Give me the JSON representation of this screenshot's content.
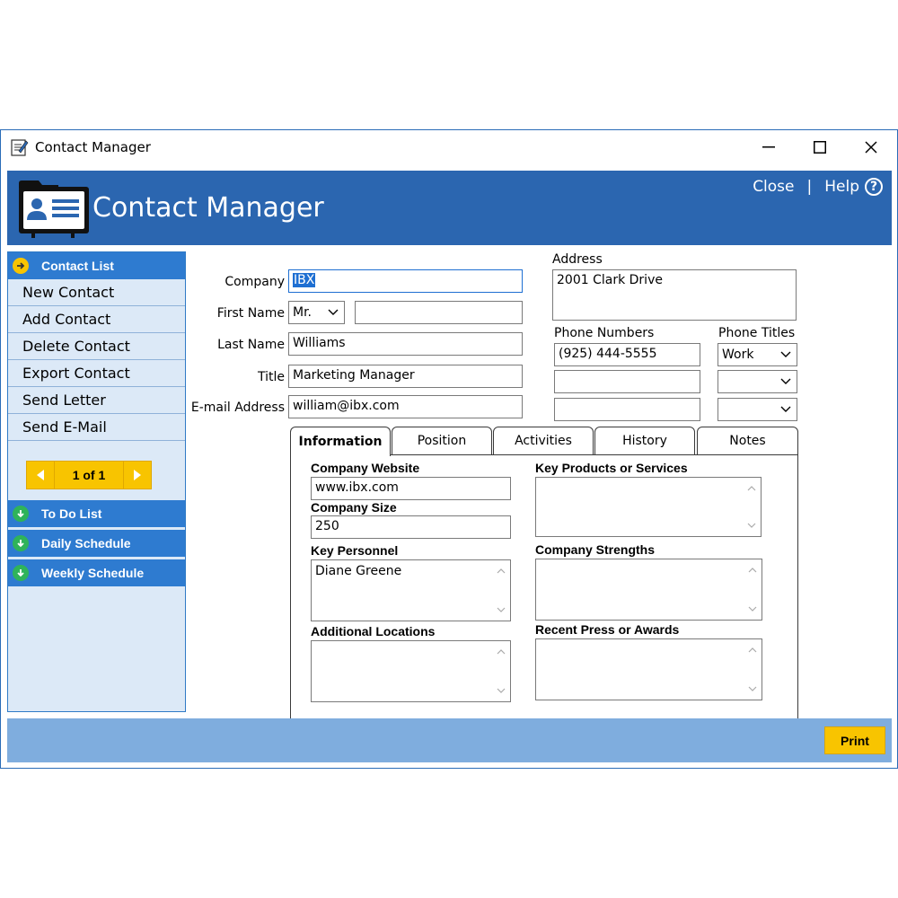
{
  "window": {
    "title": "Contact Manager"
  },
  "header": {
    "title": "Contact Manager",
    "close_label": "Close",
    "separator": "|",
    "help_label": "Help"
  },
  "sidebar": {
    "contact_list": "Contact List",
    "items": [
      "New Contact",
      "Add Contact",
      "Delete Contact",
      "Export Contact",
      "Send Letter",
      "Send E-Mail"
    ],
    "pager": "1 of 1",
    "todo": "To Do List",
    "daily": "Daily Schedule",
    "weekly": "Weekly Schedule"
  },
  "form": {
    "company_label": "Company",
    "company_value": "IBX",
    "first_name_label": "First Name",
    "salutation": "Mr.",
    "first_name_value": "",
    "last_name_label": "Last Name",
    "last_name_value": "Williams",
    "title_label": "Title",
    "title_value": "Marketing Manager",
    "email_label": "E-mail Address",
    "email_value": "william@ibx.com",
    "address_label": "Address",
    "address_value": "2001 Clark Drive",
    "phone_numbers_label": "Phone Numbers",
    "phone_titles_label": "Phone Titles",
    "phones": [
      "(925) 444-5555",
      "",
      ""
    ],
    "phone_titles": [
      "Work",
      "",
      ""
    ]
  },
  "tabs": [
    "Information",
    "Position",
    "Activities",
    "History",
    "Notes"
  ],
  "info": {
    "website_label": "Company Website",
    "website_value": "www.ibx.com",
    "size_label": "Company Size",
    "size_value": "250",
    "personnel_label": "Key Personnel",
    "personnel_value": "Diane Greene",
    "locations_label": "Additional Locations",
    "locations_value": "",
    "products_label": "Key Products or Services",
    "products_value": "",
    "strengths_label": "Company Strengths",
    "strengths_value": "",
    "press_label": "Recent Press or Awards",
    "press_value": ""
  },
  "footer": {
    "print_label": "Print"
  },
  "colors": {
    "header_blue": "#2b66b0",
    "sidebar_head": "#2e7bd0",
    "sidebar_bg": "#dce9f7",
    "accent_yellow": "#f8c400",
    "footer_blue": "#7fadde"
  }
}
